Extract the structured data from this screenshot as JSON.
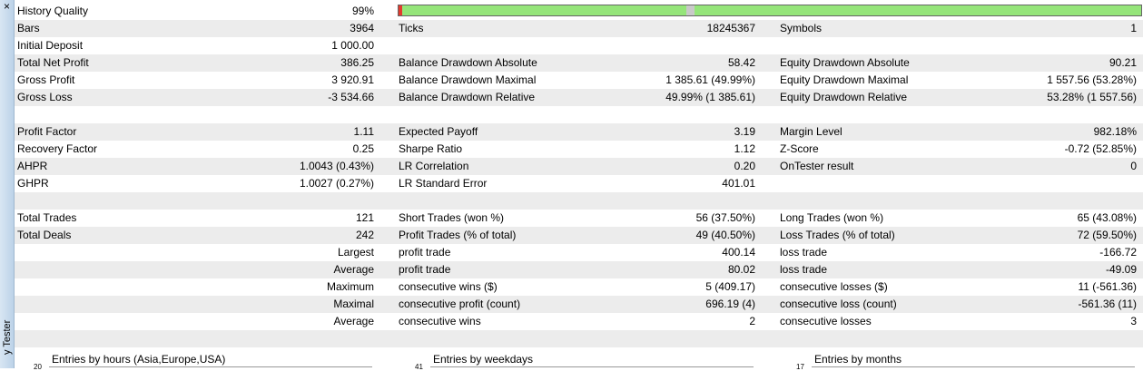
{
  "window": {
    "close_glyph": "×",
    "side_title": "y Tester"
  },
  "history_quality": {
    "label": "History Quality",
    "value": "99%",
    "fraction": 0.99
  },
  "rows": [
    {
      "c1": "Bars",
      "v1": "3964",
      "c2": "Ticks",
      "v2": "18245367",
      "c3": "Symbols",
      "v3": "1",
      "alt": true
    },
    {
      "c1": "Initial Deposit",
      "v1": "1 000.00",
      "c2": "",
      "v2": "",
      "c3": "",
      "v3": "",
      "alt": false
    },
    {
      "c1": "Total Net Profit",
      "v1": "386.25",
      "c2": "Balance Drawdown Absolute",
      "v2": "58.42",
      "c3": "Equity Drawdown Absolute",
      "v3": "90.21",
      "alt": true
    },
    {
      "c1": "Gross Profit",
      "v1": "3 920.91",
      "c2": "Balance Drawdown Maximal",
      "v2": "1 385.61 (49.99%)",
      "c3": "Equity Drawdown Maximal",
      "v3": "1 557.56 (53.28%)",
      "alt": false
    },
    {
      "c1": "Gross Loss",
      "v1": "-3 534.66",
      "c2": "Balance Drawdown Relative",
      "v2": "49.99% (1 385.61)",
      "c3": "Equity Drawdown Relative",
      "v3": "53.28% (1 557.56)",
      "alt": true
    },
    {
      "c1": "",
      "v1": "",
      "c2": "",
      "v2": "",
      "c3": "",
      "v3": "",
      "alt": false
    },
    {
      "c1": "Profit Factor",
      "v1": "1.11",
      "c2": "Expected Payoff",
      "v2": "3.19",
      "c3": "Margin Level",
      "v3": "982.18%",
      "alt": true
    },
    {
      "c1": "Recovery Factor",
      "v1": "0.25",
      "c2": "Sharpe Ratio",
      "v2": "1.12",
      "c3": "Z-Score",
      "v3": "-0.72 (52.85%)",
      "alt": false
    },
    {
      "c1": "AHPR",
      "v1": "1.0043 (0.43%)",
      "c2": "LR Correlation",
      "v2": "0.20",
      "c3": "OnTester result",
      "v3": "0",
      "alt": true
    },
    {
      "c1": "GHPR",
      "v1": "1.0027 (0.27%)",
      "c2": "LR Standard Error",
      "v2": "401.01",
      "c3": "",
      "v3": "",
      "alt": false
    },
    {
      "c1": "",
      "v1": "",
      "c2": "",
      "v2": "",
      "c3": "",
      "v3": "",
      "alt": true
    },
    {
      "c1": "Total Trades",
      "v1": "121",
      "c2": "Short Trades (won %)",
      "v2": "56 (37.50%)",
      "c3": "Long Trades (won %)",
      "v3": "65 (43.08%)",
      "alt": false
    },
    {
      "c1": "Total Deals",
      "v1": "242",
      "c2": "Profit Trades (% of total)",
      "v2": "49 (40.50%)",
      "c3": "Loss Trades (% of total)",
      "v3": "72 (59.50%)",
      "alt": true
    },
    {
      "c1": "",
      "v1": "Largest",
      "c2": "profit trade",
      "v2": "400.14",
      "c3": "loss trade",
      "v3": "-166.72",
      "alt": false
    },
    {
      "c1": "",
      "v1": "Average",
      "c2": "profit trade",
      "v2": "80.02",
      "c3": "loss trade",
      "v3": "-49.09",
      "alt": true
    },
    {
      "c1": "",
      "v1": "Maximum",
      "c2": "consecutive wins ($)",
      "v2": "5 (409.17)",
      "c3": "consecutive losses ($)",
      "v3": "11 (-561.36)",
      "alt": false
    },
    {
      "c1": "",
      "v1": "Maximal",
      "c2": "consecutive profit (count)",
      "v2": "696.19 (4)",
      "c3": "consecutive loss (count)",
      "v3": "-561.36 (11)",
      "alt": true
    },
    {
      "c1": "",
      "v1": "Average",
      "c2": "consecutive wins",
      "v2": "2",
      "c3": "consecutive losses",
      "v3": "3",
      "alt": false
    },
    {
      "c1": "",
      "v1": "",
      "c2": "",
      "v2": "",
      "c3": "",
      "v3": "",
      "alt": true
    }
  ],
  "charts": [
    {
      "title": "Entries by hours (Asia,Europe,USA)",
      "tick": "20"
    },
    {
      "title": "Entries by weekdays",
      "tick": "41"
    },
    {
      "title": "Entries by months",
      "tick": "17"
    }
  ],
  "colors": {
    "quality_bar": "#95e57a",
    "quality_error": "#e23a2e",
    "quality_missing": "#c9c9c9",
    "row_alt": "#ececec",
    "sidebar": "#c9dbee"
  }
}
